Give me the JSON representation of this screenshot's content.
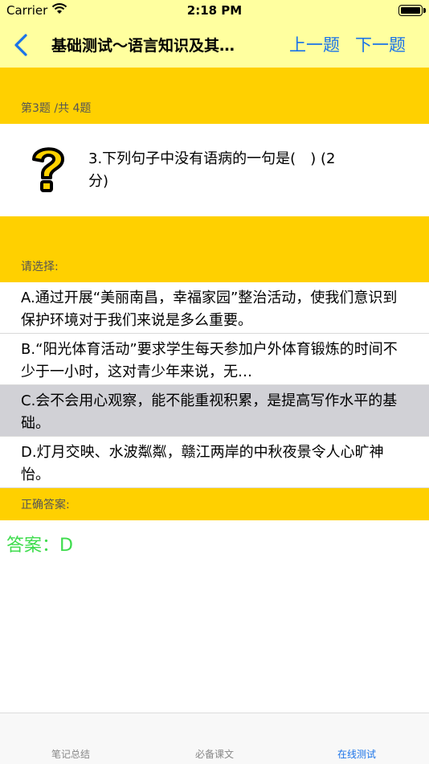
{
  "status": {
    "carrier": "Carrier",
    "time": "2:18 PM"
  },
  "nav": {
    "title": "基础测试～语言知识及其…",
    "prev_label": "上一题",
    "next_label": "下一题"
  },
  "progress": "第3题 /共 4题",
  "question": {
    "text": "3.下列句子中没有语病的一句是(　) (2分)"
  },
  "choose_label": "请选择:",
  "options": [
    {
      "text": "A.通过开展“美丽南昌，幸福家园”整治活动，使我们意识到保护环境对于我们来说是多么重要。"
    },
    {
      "text": "B.“阳光体育活动”要求学生每天参加户外体育锻炼的时间不少于一小时，这对青少年来说，无…"
    },
    {
      "text": "C.会不会用心观察，能不能重视积累，是提高写作水平的基础。",
      "selected": true
    },
    {
      "text": "D.灯月交映、水波粼粼，赣江两岸的中秋夜景令人心旷神怡。"
    }
  ],
  "answer_section_label": "正确答案:",
  "answer_text": "答案：D",
  "tabs": [
    {
      "label": "笔记总结"
    },
    {
      "label": "必备课文"
    },
    {
      "label": "在线测试",
      "active": true
    }
  ],
  "colors": {
    "accent": "#1a73e8",
    "band": "#ffd000",
    "header": "#ffff9f",
    "answer": "#3ddc4c"
  }
}
